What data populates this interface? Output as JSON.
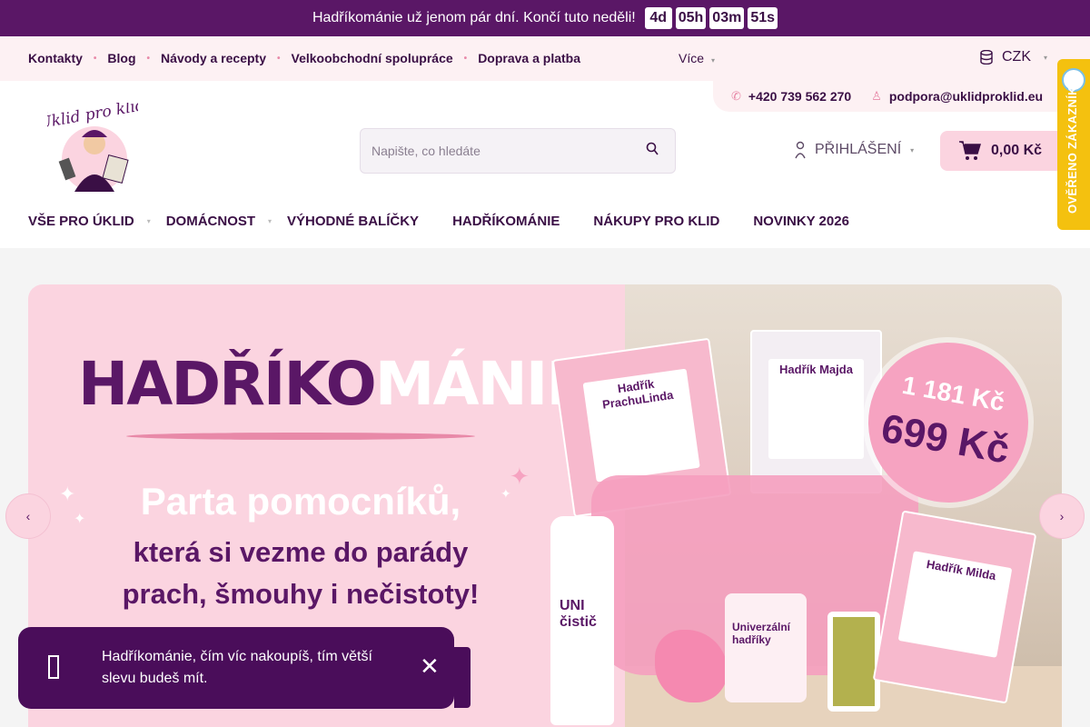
{
  "promo": {
    "text": "Hadříkománie už jenom pár dní. Končí tuto neděli!",
    "countdown": [
      "4d",
      "05h",
      "03m",
      "51s"
    ],
    "close_glyph": ""
  },
  "util_nav": {
    "links": [
      "Kontakty",
      "Blog",
      "Návody a recepty",
      "Velkoobchodní spolupráce",
      "Doprava a platba"
    ],
    "more": "Více",
    "currency": "CZK"
  },
  "contact": {
    "phone": "+420 739 562 270",
    "email": "podpora@uklidproklid.eu"
  },
  "search": {
    "placeholder": "Napište, co hledáte"
  },
  "login": {
    "label": "PŘIHLÁŠENÍ"
  },
  "cart": {
    "total": "0,00 Kč"
  },
  "main_nav": [
    "VŠE PRO ÚKLID",
    "DOMÁCNOST",
    "VÝHODNÉ BALÍČKY",
    "HADŘÍKOMÁNIE",
    "NÁKUPY PRO KLID",
    "NOVINKY 2026"
  ],
  "verified_badge": {
    "text": "OVĚŘENO ZÁKAZNÍKY"
  },
  "hero": {
    "title_a": "HADŘÍKO",
    "title_b": "MÁNIE",
    "line1": "Parta pomocníků,",
    "line2": "která si vezme do parády",
    "line3": "prach, šmouhy i nečistoty!",
    "price_old": "1 181 Kč",
    "price_new": "699 Kč",
    "products": {
      "cloth1": "Hadřík PrachuLinda",
      "cloth2": "Hadřík Majda",
      "cloth3": "Hadřík Milda",
      "bottle": "UNI čistič",
      "roll": "Univerzální hadříky"
    }
  },
  "toast": {
    "message": "Hadříkománie, čím víc nakoupíš, tím větší slevu budeš mít.",
    "close_glyph": "✕"
  },
  "colors": {
    "primary": "#5a1766",
    "pink_light": "#fbd4e0",
    "pink_accent": "#e889a8",
    "badge_yellow": "#f4c10f"
  }
}
